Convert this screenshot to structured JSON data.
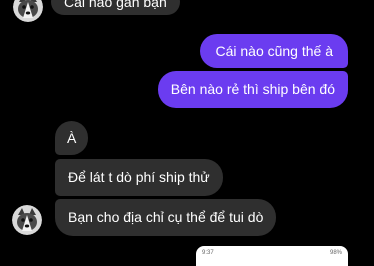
{
  "colors": {
    "background": "#000000",
    "incoming_bubble": "#2f2f2f",
    "outgoing_bubble": "#6b3cf0",
    "text": "#ffffff"
  },
  "messages": [
    {
      "direction": "incoming",
      "text": "Cái nào gần bạn"
    },
    {
      "direction": "outgoing",
      "text": "Cái nào cũng thế à"
    },
    {
      "direction": "outgoing",
      "text": "Bên nào rẻ thì ship bên đó"
    },
    {
      "direction": "incoming",
      "text": "À"
    },
    {
      "direction": "incoming",
      "text": "Để lát t dò phí ship thử"
    },
    {
      "direction": "incoming",
      "text": "Bạn cho địa chỉ cụ thể để tui dò"
    }
  ],
  "avatar_icon": "husky-dog-avatar-icon",
  "attachment_preview": {
    "status_time": "9:37",
    "status_battery": "98%"
  }
}
